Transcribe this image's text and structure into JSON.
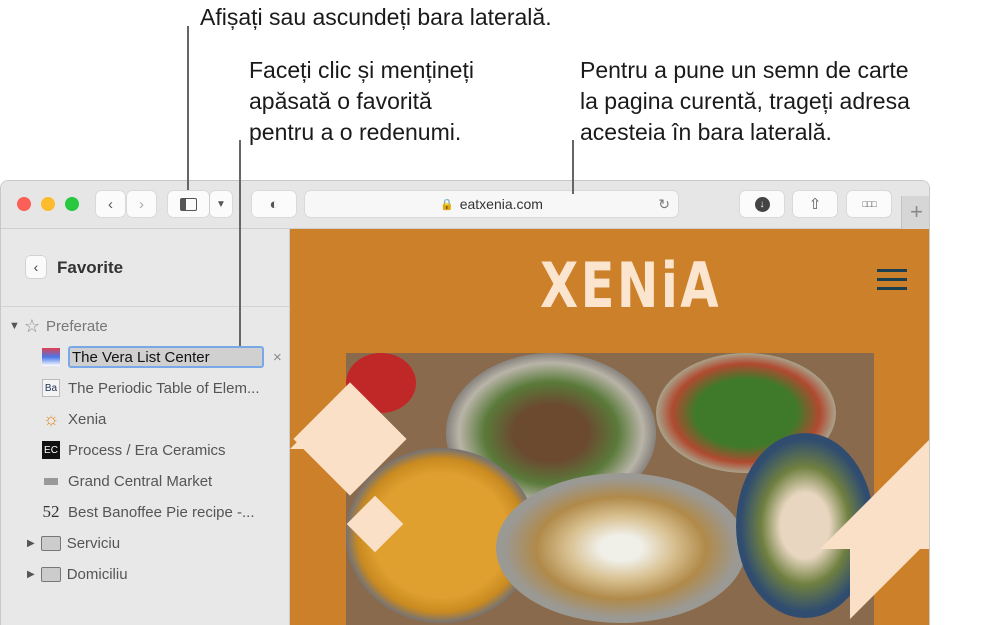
{
  "callouts": {
    "sidebar_toggle": "Afișați sau ascundeți bara laterală.",
    "rename": [
      "Faceți clic și mențineți",
      "apăsată o favorită",
      "pentru a o redenumi."
    ],
    "bookmark": [
      "Pentru a pune un semn de carte",
      "la pagina curentă, trageți adresa",
      "acesteia în bara laterală."
    ]
  },
  "toolbar": {
    "back_icon": "chevron-left",
    "forward_icon": "chevron-right",
    "sidebar_icon": "sidebar",
    "dropdown_icon": "chevron-down",
    "privacy_icon": "shield",
    "url": "eatxenia.com",
    "lock_icon": "lock",
    "reload_icon": "reload",
    "download_icon": "download",
    "share_icon": "share",
    "tabs_icon": "grid",
    "new_tab": "+"
  },
  "sidebar": {
    "title": "Favorite",
    "section": "Preferate",
    "editing_value": "The Vera List Center",
    "items": [
      {
        "label": "The Periodic Table of Elem...",
        "icon": "Ba"
      },
      {
        "label": "Xenia",
        "icon": "sun"
      },
      {
        "label": "Process / Era Ceramics",
        "icon": "EC"
      },
      {
        "label": "Grand Central Market",
        "icon": "gcm"
      },
      {
        "label": "Best Banoffee Pie recipe -...",
        "icon": "52"
      }
    ],
    "folders": [
      {
        "label": "Serviciu"
      },
      {
        "label": "Domiciliu"
      }
    ]
  },
  "page": {
    "logo": "XENiA",
    "accent": "#cc8029",
    "menu_icon": "hamburger"
  }
}
